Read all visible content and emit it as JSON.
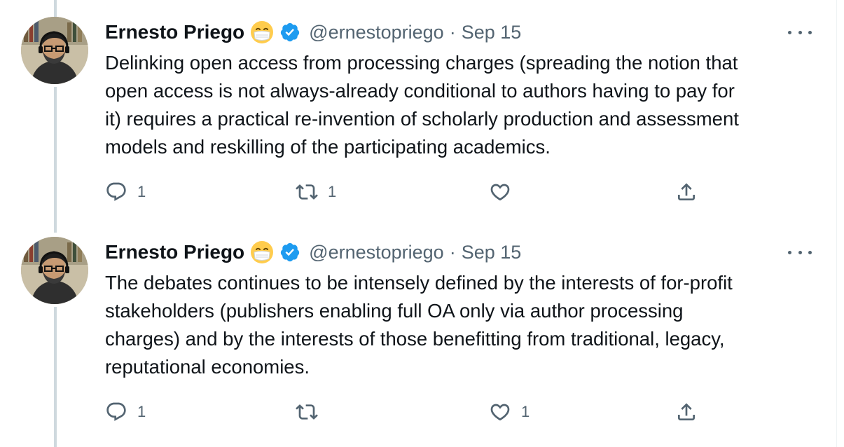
{
  "tweets": [
    {
      "author_name": "Ernesto Priego",
      "handle": "@ernestopriego",
      "separator": "·",
      "date": "Sep 15",
      "text": "Delinking open access from processing charges (spreading the notion that\nopen access is not always-already conditional to authors having to pay for\nit) requires a practical re-invention of scholarly production and assessment\nmodels and reskilling of the participating academics.",
      "reply_count": "1",
      "retweet_count": "1",
      "like_count": ""
    },
    {
      "author_name": "Ernesto Priego",
      "handle": "@ernestopriego",
      "separator": "·",
      "date": "Sep 15",
      "text": "The debates continues to be intensely defined by the interests of for-profit\nstakeholders (publishers enabling full OA only via author processing\ncharges) and by the interests of those benefitting from traditional, legacy,\nreputational economies.",
      "reply_count": "1",
      "retweet_count": "",
      "like_count": "1"
    }
  ],
  "icons": {
    "emoji": "face-with-medical-mask-icon",
    "verified": "verified-badge-icon",
    "more": "more-options-icon",
    "reply": "reply-icon",
    "retweet": "retweet-icon",
    "like": "heart-icon",
    "share": "share-icon"
  },
  "colors": {
    "text": "#0f1419",
    "secondary": "#536471",
    "verified": "#1d9bf0",
    "thread_line": "#cfd9de",
    "emoji_face": "#ffcc4d",
    "mask": "#ffffff"
  }
}
